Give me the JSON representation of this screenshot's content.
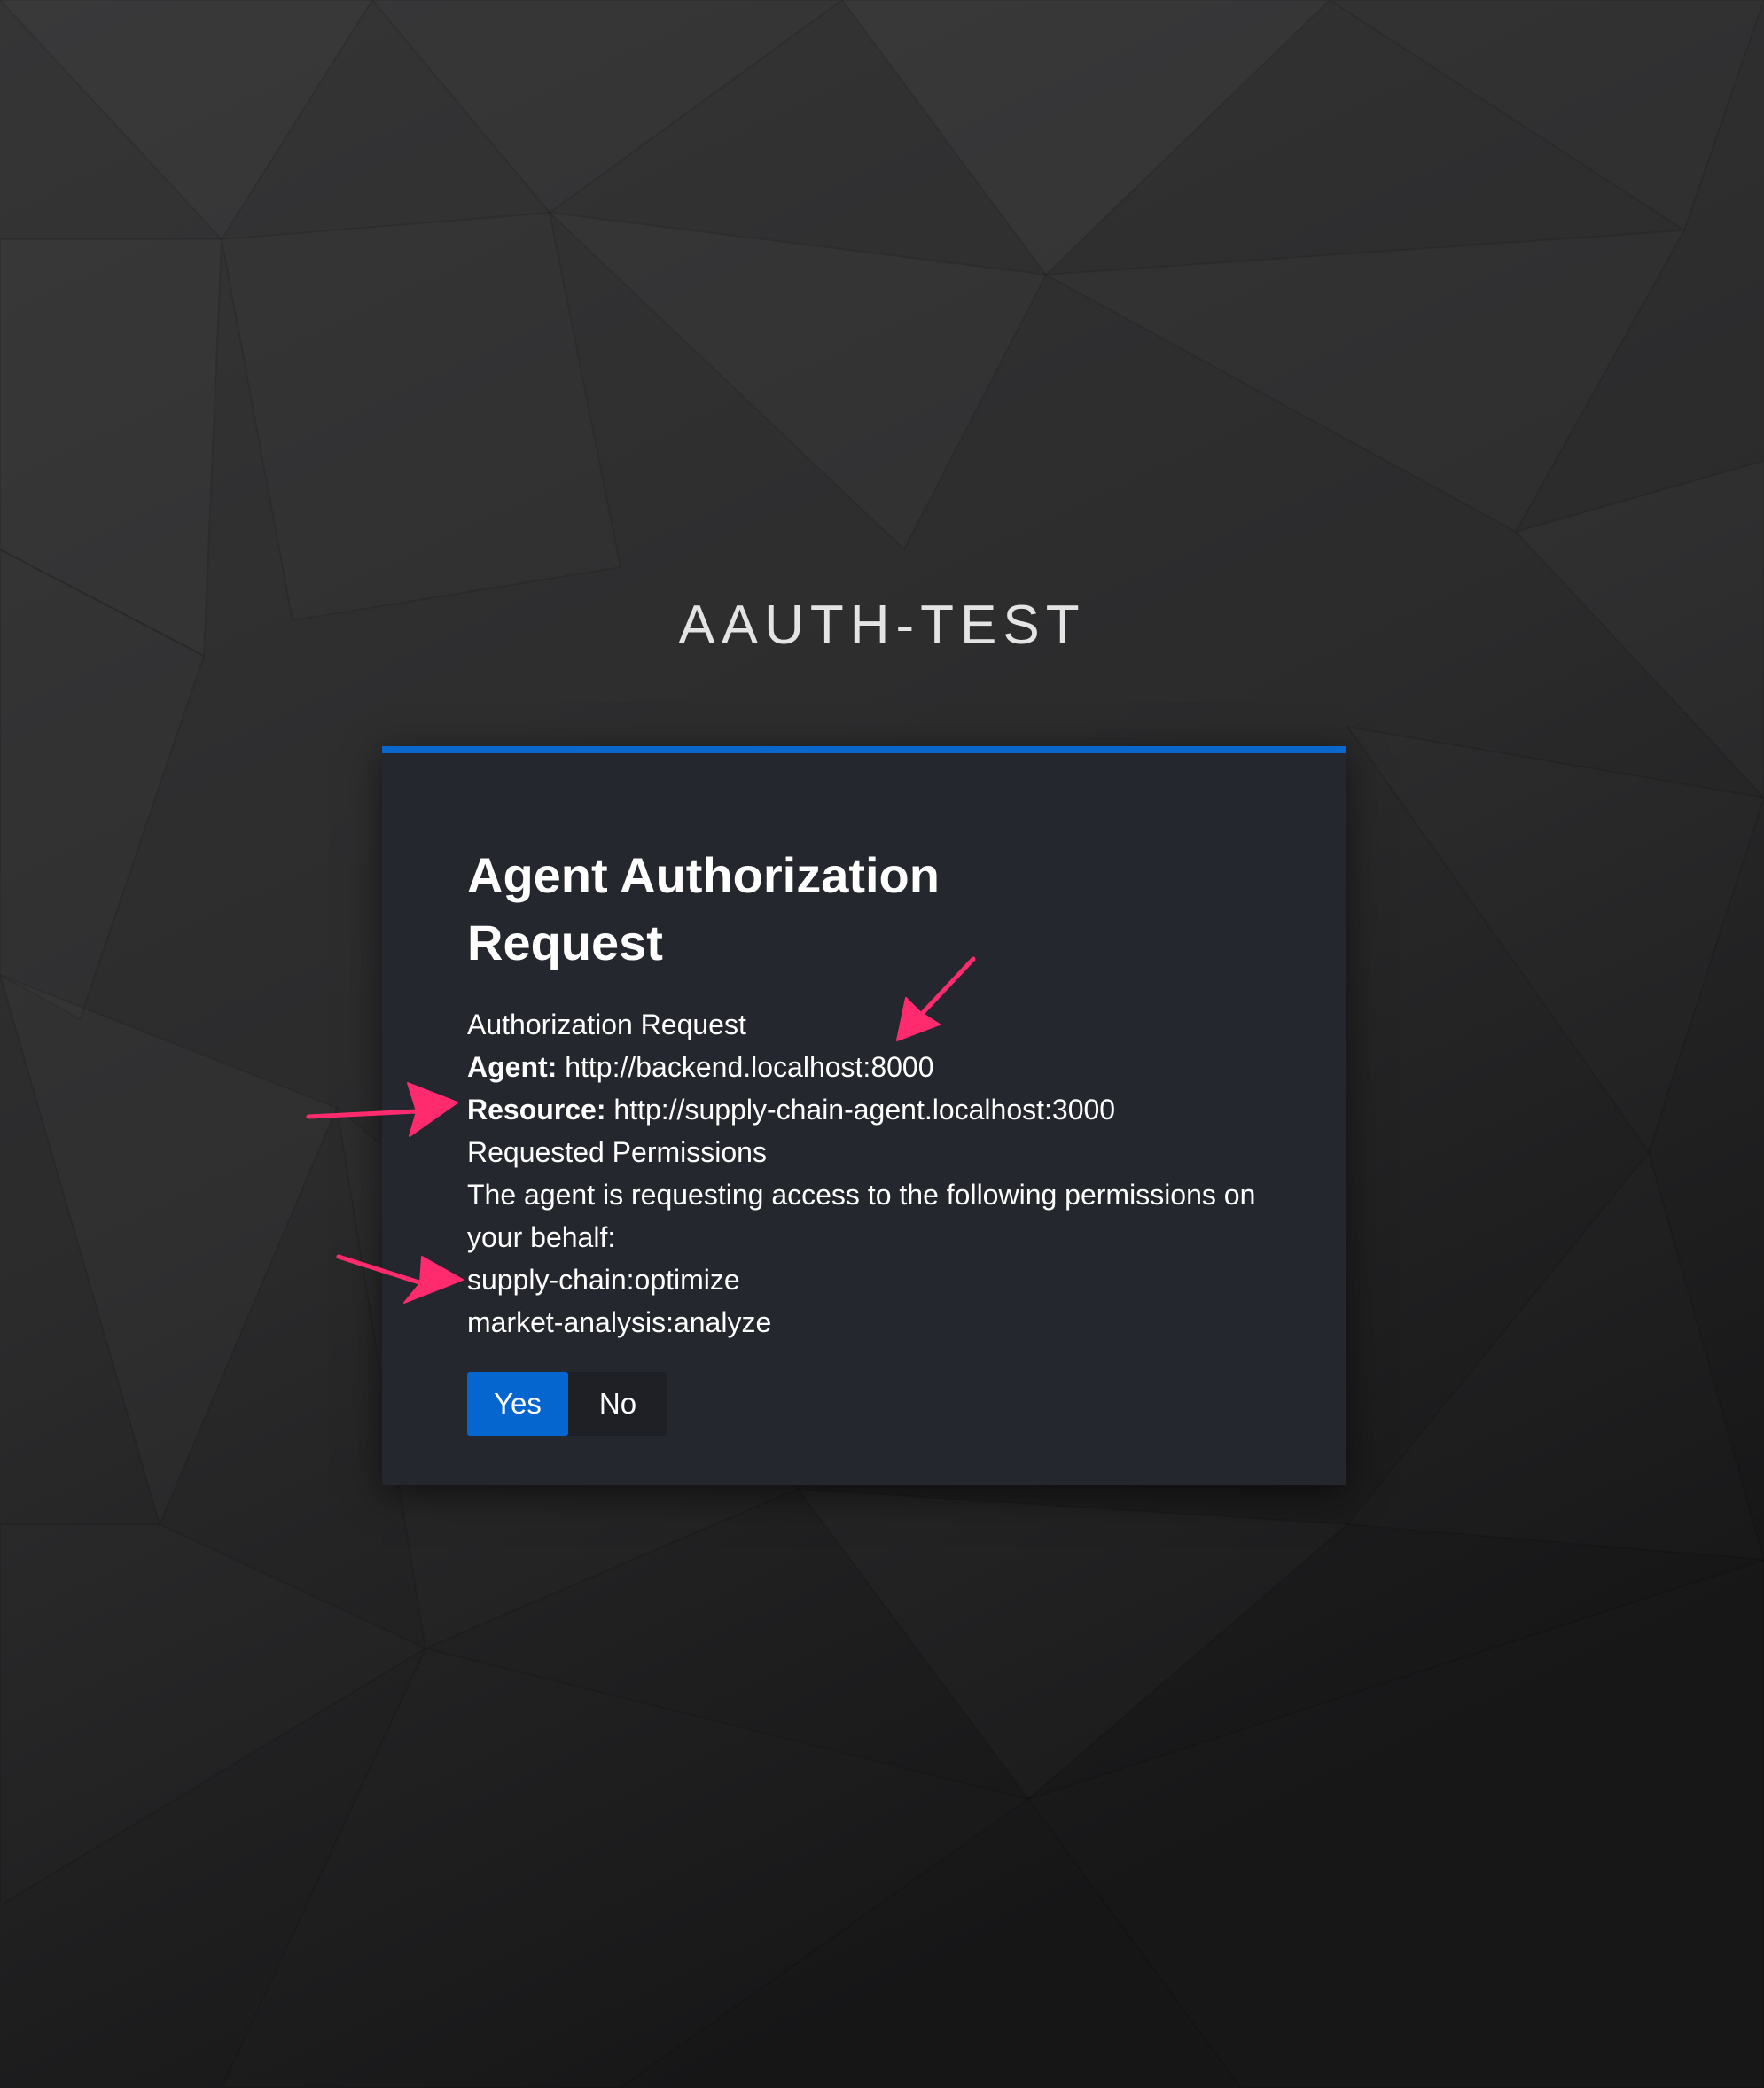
{
  "realm": {
    "title": "AAUTH-TEST"
  },
  "card": {
    "title": "Agent Authorization Request",
    "subtitle": "Authorization Request",
    "agent_label": "Agent:",
    "agent_value": "http://backend.localhost:8000",
    "resource_label": "Resource:",
    "resource_value": "http://supply-chain-agent.localhost:3000",
    "permissions_heading": "Requested Permissions",
    "permissions_description": "The agent is requesting access to the following permissions on your behalf:",
    "permissions": [
      "supply-chain:optimize",
      "market-analysis:analyze"
    ]
  },
  "buttons": {
    "yes_label": "Yes",
    "no_label": "No"
  },
  "colors": {
    "accent": "#0566d0",
    "card_background": "#24272d",
    "annotation_arrow": "#ff2b6e"
  },
  "annotations": {
    "arrow_icon": "pink-arrow-icon",
    "count": 3
  }
}
